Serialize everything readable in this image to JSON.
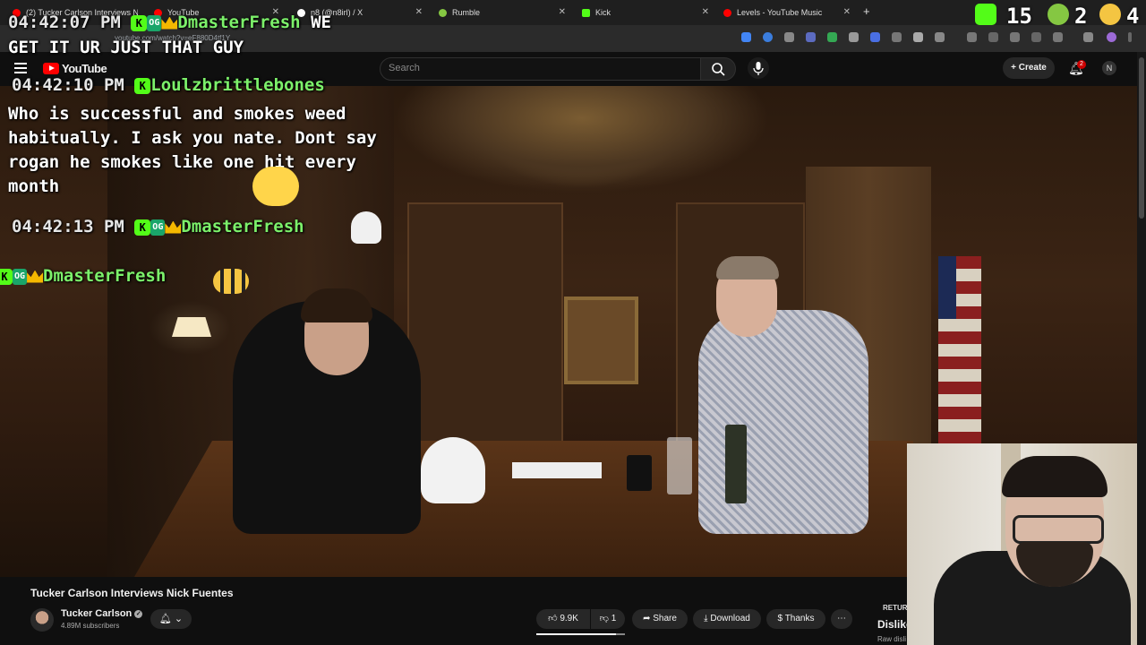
{
  "browser": {
    "tabs": [
      {
        "label": "(2) Tucker Carlson Interviews N",
        "color": "#ff0000"
      },
      {
        "label": "YouTube",
        "color": "#ff0000"
      },
      {
        "label": "n8 (@n8irl) / X",
        "color": "#ffffff"
      },
      {
        "label": "Rumble",
        "color": "#85c742"
      },
      {
        "label": "Kick",
        "color": "#53fc18"
      },
      {
        "label": "Levels - YouTube Music",
        "color": "#ff0000"
      }
    ],
    "new_tab": "+",
    "url": "youtube.com/watch?v=eF880D4tf1Y"
  },
  "stream_stats": {
    "kick_count": "15",
    "rumble_count": "2",
    "other_count": "4"
  },
  "youtube": {
    "logo_text": "YouTube",
    "search_placeholder": "Search",
    "create_label": "Create",
    "notif_count": "2",
    "account_initial": "N"
  },
  "chat": [
    {
      "timestamp": "04:42:07 PM",
      "user": "DmasterFresh",
      "text": "WE"
    },
    {
      "text_cont": "GET IT UR JUST THAT GUY"
    },
    {
      "timestamp": "04:42:10 PM",
      "user": "Loulzbrittlebones",
      "message": "Who is successful and smokes weed habitually. I ask you nate. Dont say rogan he smokes like one hit every month"
    },
    {
      "timestamp": "04:42:13 PM",
      "user": "DmasterFresh"
    },
    {
      "user": "DmasterFresh"
    }
  ],
  "video": {
    "title": "Tucker Carlson Interviews Nick Fuentes",
    "channel": "Tucker Carlson",
    "subscribers": "4.89M subscribers",
    "likes": "9.9K",
    "like_fraction": 0.9,
    "dislikes": "1",
    "share_label": "Share",
    "download_label": "Download",
    "thanks_label": "Thanks",
    "more_label": "⋯"
  },
  "rydislike": {
    "badge": "RETURN",
    "label": "Dislike",
    "sub": "Raw disli"
  },
  "colors": {
    "kick_green": "#53fc18",
    "yt_red": "#ff0000",
    "username_green": "#7cf06a"
  }
}
